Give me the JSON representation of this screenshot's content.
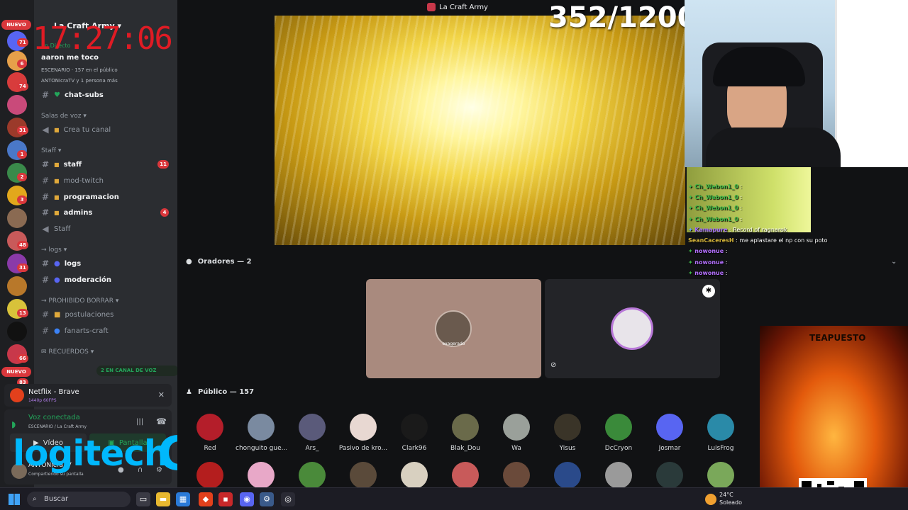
{
  "window": {
    "title": "La Craft Army"
  },
  "overlay": {
    "clock": "17:27:06",
    "counter": "352/1200"
  },
  "server_rail": {
    "top_badge": "NUEVO",
    "second_badge": "NUEVO",
    "counts": [
      "71",
      "6",
      "74",
      "31",
      "1",
      "2",
      "3",
      "48",
      "31",
      "13",
      "66",
      "83"
    ]
  },
  "sidebar": {
    "server_name": "La Craft Army",
    "live_label": "En Directo",
    "live_title": "aaron me toco",
    "live_meta": "ESCENARIO · 157 en el público",
    "live_meta2": "ANTONIcraTV y 1 persona más",
    "channels": [
      {
        "label": "chat-subs"
      },
      {
        "label": "Crea tu canal"
      },
      {
        "label": "staff",
        "badge": "11"
      },
      {
        "label": "mod-twitch"
      },
      {
        "label": "programacion"
      },
      {
        "label": "admins",
        "badge": "4"
      },
      {
        "label": "Staff"
      },
      {
        "label": "logs"
      },
      {
        "label": "moderación"
      },
      {
        "label": "postulaciones"
      },
      {
        "label": "fanarts-craft"
      }
    ],
    "categories": {
      "voice": "Salas de voz",
      "staff": "Staff",
      "logs": "logs",
      "prohibido": "PROHIBIDO BORRAR",
      "recuerdos": "RECUERDOS"
    },
    "voice_pill": "2 EN CANAL DE VOZ"
  },
  "stream_panel": {
    "title": "Netflix - Brave",
    "quality": "1440p 60FPS"
  },
  "voice_panel": {
    "status": "Voz conectada",
    "location": "ESCENARIO / La Craft Army",
    "video_label": "Vídeo",
    "screen_label": "Pantalla",
    "user_name": "ANTONIcraTV",
    "user_status": "Compartiendo su pantalla"
  },
  "overlay_brand": {
    "logo": "logitech",
    "g": "G"
  },
  "chat_overlay": [
    {
      "user": "Ch_Webon1_0",
      "msg": "",
      "color": "#3fb848"
    },
    {
      "user": "Ch_Webon1_0",
      "msg": "",
      "color": "#3fb848"
    },
    {
      "user": "Ch_Webon1_0",
      "msg": "",
      "color": "#3fb848"
    },
    {
      "user": "Ch_Webon1_0",
      "msg": "",
      "color": "#3fb848"
    },
    {
      "user": "Kamapure",
      "msg": "Record of ragnarok",
      "color": "#a06cff"
    },
    {
      "user": "SeanCaceresH",
      "msg": "me aplastare el np con su poto",
      "color": "#d4b43a"
    },
    {
      "user": "nowonue",
      "msg": "",
      "color": "#b470ff"
    },
    {
      "user": "nowonue",
      "msg": "",
      "color": "#b470ff"
    },
    {
      "user": "nowonue",
      "msg": "",
      "color": "#b470ff"
    }
  ],
  "stage": {
    "speakers_title": "Oradores — 2",
    "speaker_label": "exagerado",
    "public_title": "Público — 157",
    "public_users": [
      "Red",
      "chonguito gue...",
      "Ars_",
      "Pasivo de kro...",
      "Clark96",
      "Blak_Dou",
      "Wa",
      "Yisus",
      "DcCryon",
      "Josmar",
      "LuisFrog"
    ]
  },
  "promo": {
    "title": "TEAPUESTO"
  },
  "taskbar": {
    "search_placeholder": "Buscar",
    "temp": "24°C",
    "weather": "Soleado"
  },
  "colors": {
    "accent": "#5865f2",
    "online": "#23a55a",
    "alert": "#da373c"
  }
}
